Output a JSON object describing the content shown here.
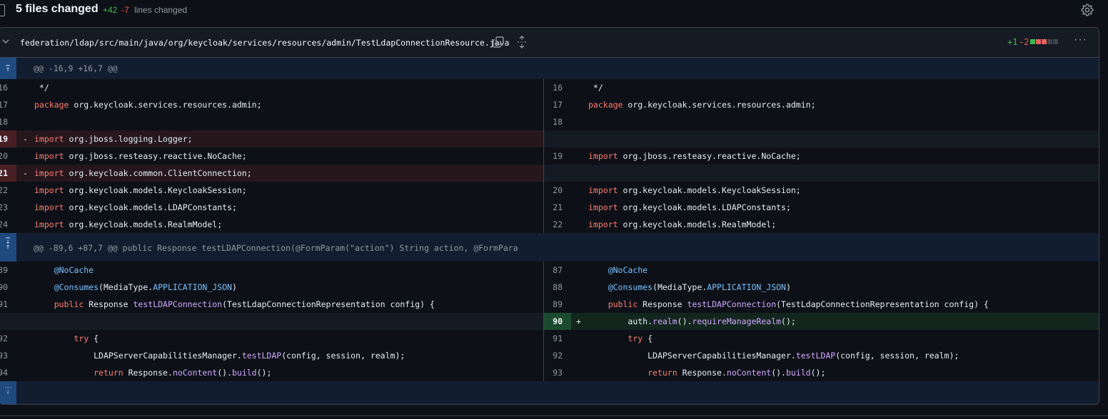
{
  "summary": {
    "title": "5 files changed",
    "additions": "+42",
    "deletions": "-7",
    "lines_changed_label": "lines changed"
  },
  "file": {
    "path": "federation/ldap/src/main/java/org/keycloak/services/resources/admin/TestLdapConnectionResource.java",
    "stat_add": "+1",
    "stat_del": "-2",
    "kebab": "···"
  },
  "hunks": [
    {
      "header": "@@ -16,9 +16,7 @@"
    },
    {
      "header": "@@ -89,6 +87,7 @@ public Response testLDAPConnection(@FormParam(\"action\") String action, @FormPara"
    }
  ],
  "lines": {
    "l16": {
      "num": "16",
      "code": " */"
    },
    "l17": {
      "num": "17",
      "code": "org.keycloak.services.resources.admin;"
    },
    "l18": {
      "num": "18"
    },
    "l19": {
      "num": "19",
      "code": "org.jboss.logging.Logger;"
    },
    "l20": {
      "num": "20",
      "code": "org.jboss.resteasy.reactive.NoCache;"
    },
    "l21": {
      "num": "21",
      "code": "org.keycloak.common.ClientConnection;"
    },
    "l22": {
      "num": "22",
      "code": "org.keycloak.models.KeycloakSession;"
    },
    "l23": {
      "num": "23",
      "code": "org.keycloak.models.LDAPConstants;"
    },
    "l24": {
      "num": "24",
      "code": "org.keycloak.models.RealmModel;"
    },
    "r16": {
      "num": "16",
      "code": " */"
    },
    "r17": {
      "num": "17",
      "code": "org.keycloak.services.resources.admin;"
    },
    "r18": {
      "num": "18"
    },
    "r19": {
      "num": "19",
      "code": "org.jboss.resteasy.reactive.NoCache;"
    },
    "r20": {
      "num": "20",
      "code": "org.keycloak.models.KeycloakSession;"
    },
    "r21": {
      "num": "21",
      "code": "org.keycloak.models.LDAPConstants;"
    },
    "r22": {
      "num": "22",
      "code": "org.keycloak.models.RealmModel;"
    },
    "l89": {
      "num": "89"
    },
    "l90": {
      "num": "90"
    },
    "l91": {
      "num": "91"
    },
    "l92": {
      "num": "92"
    },
    "l93": {
      "num": "93"
    },
    "l94": {
      "num": "94"
    },
    "r87": {
      "num": "87"
    },
    "r88": {
      "num": "88"
    },
    "r89": {
      "num": "89"
    },
    "r90": {
      "num": "90"
    },
    "r91": {
      "num": "91"
    },
    "r92": {
      "num": "92"
    },
    "r93": {
      "num": "93"
    }
  },
  "tokens": {
    "package": "package",
    "import": "import",
    "nocache": "@NoCache",
    "consumes": "@Consumes",
    "consumes_arg_a": "(MediaType.",
    "consumes_arg_b": "APPLICATION_JSON",
    "consumes_arg_c": ")",
    "public": "public",
    "response": " Response ",
    "test_ldap_conn": "testLDAPConnection",
    "test_ldap_conn_args": "(TestLdapConnectionRepresentation config) {",
    "try": "try",
    "try_brace": " {",
    "manager": "LDAPServerCapabilitiesManager.",
    "test_ldap": "testLDAP",
    "test_ldap_args": "(config, session, realm);",
    "return": "return",
    "response_dot": " Response.",
    "no_content": "noContent",
    "paren_dot": "().",
    "build": "build",
    "build_end": "();",
    "auth": "auth.",
    "realm": "realm",
    "require": "requireManageRealm",
    "require_end": "();",
    "minus": "-",
    "plus": "+"
  },
  "colors": {
    "addition": "#3fb950",
    "deletion": "#f85149",
    "keyword": "#ff7b72",
    "annotation": "#79c0ff",
    "function": "#d2a8ff"
  }
}
